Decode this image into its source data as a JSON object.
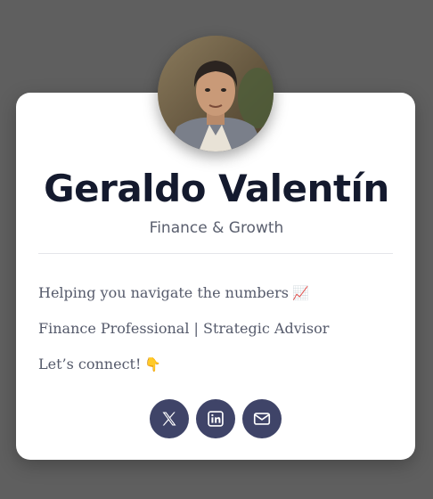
{
  "profile": {
    "name": "Geraldo Valentín",
    "subtitle": "Finance & Growth"
  },
  "bio": [
    {
      "text": "Helping you navigate the numbers",
      "emoji": "📈"
    },
    {
      "text": "Finance Professional | Strategic Advisor",
      "emoji": ""
    },
    {
      "text": "Let’s connect!",
      "emoji": "👇"
    }
  ],
  "socials": [
    {
      "icon": "x-twitter-icon"
    },
    {
      "icon": "linkedin-icon"
    },
    {
      "icon": "mail-icon"
    }
  ],
  "colors": {
    "background": "#5f5f5f",
    "card": "#ffffff",
    "accent": "#3f4468",
    "name": "#141a2e"
  }
}
